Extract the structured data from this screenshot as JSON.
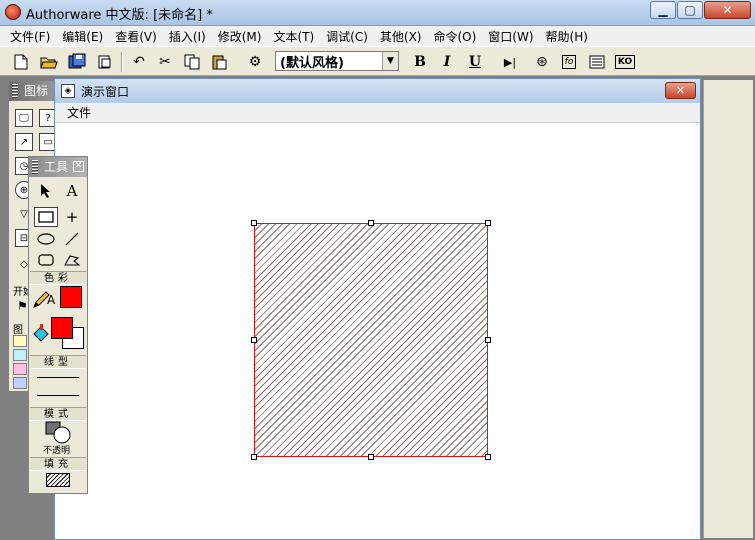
{
  "window": {
    "title": "Authorware 中文版: [未命名] *"
  },
  "menubar": {
    "items": [
      {
        "label": "文件(F)"
      },
      {
        "label": "编辑(E)"
      },
      {
        "label": "查看(V)"
      },
      {
        "label": "插入(I)"
      },
      {
        "label": "修改(M)"
      },
      {
        "label": "文本(T)"
      },
      {
        "label": "调试(C)"
      },
      {
        "label": "其他(X)"
      },
      {
        "label": "命令(O)"
      },
      {
        "label": "窗口(W)"
      },
      {
        "label": "帮助(H)"
      }
    ]
  },
  "toolbar": {
    "style_value": "(默认风格)",
    "bold_label": "B",
    "italic_label": "I",
    "underline_label": "U",
    "functions_label": "fo",
    "knowledge_label": "KO"
  },
  "icon_palette": {
    "title": "图标",
    "start_label": "开始",
    "map_label": "图"
  },
  "demo_window": {
    "title": "演示窗口",
    "menu_file": "文件"
  },
  "tools_panel": {
    "title": "工具",
    "color_label": "色彩",
    "line_label": "线型",
    "mode_label": "模式",
    "mode_value": "不透明",
    "fill_label": "填充",
    "stroke_color": "#ff0000",
    "fill_color": "#ff0000",
    "background_color": "#ffffff"
  }
}
